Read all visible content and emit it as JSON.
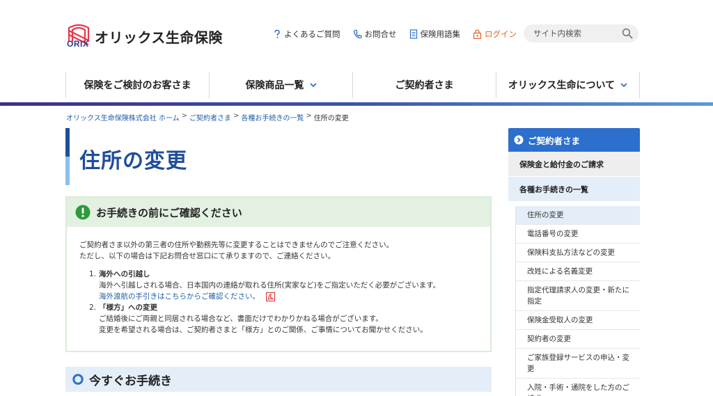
{
  "brand": {
    "logo_text": "ORIX",
    "company_name": "オリックス生命保険"
  },
  "utility_nav": {
    "faq": "よくあるご質問",
    "contact": "お問合せ",
    "glossary": "保険用語集",
    "login": "ログイン"
  },
  "search": {
    "placeholder": "サイト内検索"
  },
  "global_nav": [
    {
      "label": "保険をご検討のお客さま",
      "has_dropdown": false
    },
    {
      "label": "保険商品一覧",
      "has_dropdown": true
    },
    {
      "label": "ご契約者さま",
      "has_dropdown": false
    },
    {
      "label": "オリックス生命について",
      "has_dropdown": true
    }
  ],
  "breadcrumb": {
    "items": [
      "オリックス生命保険株式会社 ホーム",
      "ご契約者さま",
      "各種お手続きの一覧"
    ],
    "separator": ">",
    "current": "住所の変更"
  },
  "page_title": "住所の変更",
  "notice": {
    "title": "お手続きの前にご確認ください",
    "intro_1": "ご契約者さま以外の第三者の住所や勤務先等に変更することはできませんのでご注意ください。",
    "intro_2": "ただし、以下の場合は下記お問合せ窓口にて承りますので、ご連絡ください。",
    "items": [
      {
        "num": "1.",
        "heading": "海外への引越し",
        "text": "海外へ引越しされる場合、日本国内の連絡が取れる住所(実家など)をご指定いただく必要がございます。",
        "link": "海外渡航の手引きはこちらからご確認ください。"
      },
      {
        "num": "2.",
        "heading": "「様方」への変更",
        "text_1": "ご結婚後にご両親と同居される場合など、書面だけでわかりかねる場合がございます。",
        "text_2": "変更を希望される場合は、ご契約者さまと「様方」とのご関係、ご事情についてお聞かせください。"
      }
    ]
  },
  "section": {
    "title": "今すぐお手続き"
  },
  "sidebar": {
    "header": "ご契約者さま",
    "level1": [
      {
        "label": "保険金と給付金のご請求"
      },
      {
        "label": "各種お手続きの一覧"
      }
    ],
    "level2": [
      {
        "label": "住所の変更"
      },
      {
        "label": "電話番号の変更"
      },
      {
        "label": "保険料支払方法などの変更"
      },
      {
        "label": "改姓による名義変更"
      },
      {
        "label": "指定代理請求人の変更・新たに指定"
      },
      {
        "label": "保険金受取人の変更"
      },
      {
        "label": "契約者の変更"
      },
      {
        "label": "ご家族登録サービスの申込・変更"
      },
      {
        "label": "入院・手術・通院をした方のご請求"
      }
    ]
  },
  "colors": {
    "brand_blue": "#1f4e9a",
    "accent_orange": "#e0611f",
    "notice_green": "#2f9a3c",
    "sidebar_blue": "#2c6fcc",
    "link_blue": "#1f5da6"
  }
}
